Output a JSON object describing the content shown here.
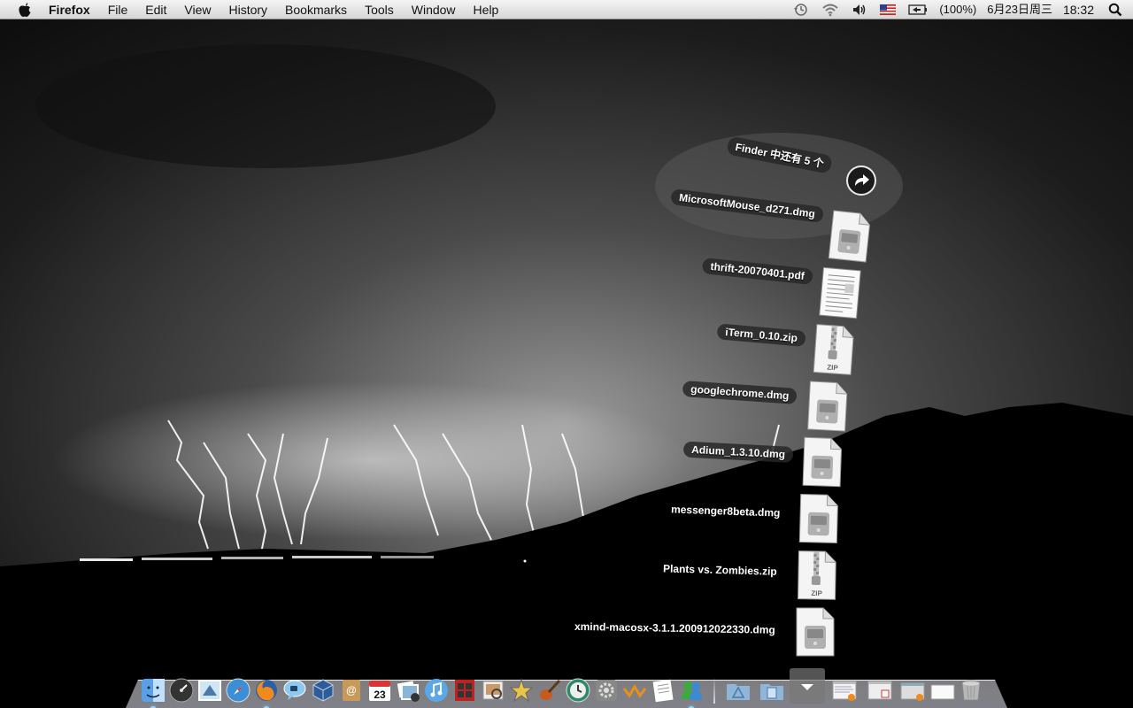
{
  "menubar": {
    "app_name": "Firefox",
    "menus": [
      "File",
      "Edit",
      "View",
      "History",
      "Bookmarks",
      "Tools",
      "Window",
      "Help"
    ],
    "battery_text": "(100%)",
    "date_text": "6月23日周三",
    "time_text": "18:32",
    "status_icons": [
      "time-machine-icon",
      "wifi-icon",
      "volume-icon",
      "us-flag-input-icon",
      "battery-icon",
      "spotlight-icon"
    ]
  },
  "stack": {
    "header": "Finder 中还有 5 个",
    "items": [
      {
        "name": "MicrosoftMouse_d271.dmg",
        "kind": "dmg"
      },
      {
        "name": "thrift-20070401.pdf",
        "kind": "pdf"
      },
      {
        "name": "iTerm_0.10.zip",
        "kind": "zip"
      },
      {
        "name": "googlechrome.dmg",
        "kind": "dmg"
      },
      {
        "name": "Adium_1.3.10.dmg",
        "kind": "dmg"
      },
      {
        "name": "messenger8beta.dmg",
        "kind": "dmg"
      },
      {
        "name": "Plants vs. Zombies.zip",
        "kind": "zip"
      },
      {
        "name": "xmind-macosx-3.1.1.200912022330.dmg",
        "kind": "dmg"
      }
    ]
  },
  "dock": {
    "apps": [
      "finder-icon",
      "dashboard-icon",
      "mail-stamp-icon",
      "safari-icon",
      "firefox-icon",
      "ichat-icon",
      "virtualbox-icon",
      "address-book-icon",
      "ical-icon",
      "iphoto-icon",
      "itunes-icon",
      "photo-booth-icon",
      "preview-icon",
      "imovie-icon",
      "garageband-icon",
      "time-machine-icon",
      "system-preferences-icon",
      "growl-icon",
      "textedit-icon",
      "messenger-icon"
    ],
    "calendar_day": "23",
    "right": [
      "applications-stack-icon",
      "documents-stack-icon",
      "downloads-stack-icon",
      "window-thumb-1",
      "window-thumb-2",
      "window-thumb-3",
      "window-thumb-4",
      "trash-icon"
    ]
  },
  "colors": {
    "menubar_bg": "#e6e6e6",
    "label_bg": "#282828",
    "dmg_disk": "#b0b0b0"
  }
}
